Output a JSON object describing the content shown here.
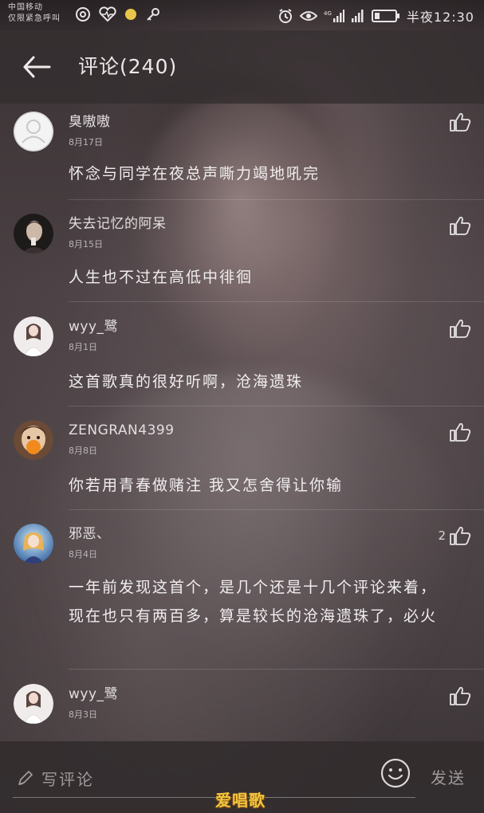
{
  "status_bar": {
    "carrier_line1": "中国移动",
    "carrier_line2": "仅限紧急呼叫",
    "time_label": "半夜12:30"
  },
  "header": {
    "title": "评论(240)"
  },
  "comments": [
    {
      "username": "臭嗷嗷",
      "date": "8月17日",
      "content": "怀念与同学在夜总声嘶力竭地吼完",
      "like_count": "",
      "avatar": "default-avatar"
    },
    {
      "username": "失去记忆的阿呆",
      "date": "8月15日",
      "content": "人生也不过在高低中徘徊",
      "like_count": "",
      "avatar": "portrait-avatar"
    },
    {
      "username": "wyy_鹭",
      "date": "8月1日",
      "content": "这首歌真的很好听啊，沧海遗珠",
      "like_count": "",
      "avatar": "girl-avatar"
    },
    {
      "username": "ZENGRAN4399",
      "date": "8月8日",
      "content": "你若用青春做赌注 我又怎舍得让你输",
      "like_count": "",
      "avatar": "kid-avatar"
    },
    {
      "username": "邪恶、",
      "date": "8月4日",
      "content": "一年前发现这首个，是几个还是十几个评论来着，现在也只有两百多，算是较长的沧海遗珠了，必火",
      "like_count": "2",
      "avatar": "anime-avatar"
    },
    {
      "username": "wyy_鹭",
      "date": "8月3日",
      "content": "",
      "like_count": "",
      "avatar": "girl-avatar"
    }
  ],
  "input_bar": {
    "placeholder": "写评论",
    "send_label": "发送",
    "watermark": "爱唱歌"
  },
  "colors": {
    "background": "#3a3234",
    "header": "#342e30",
    "text_primary": "#f1eeef",
    "text_secondary": "#b9b4b5",
    "watermark": "#f2c640"
  }
}
